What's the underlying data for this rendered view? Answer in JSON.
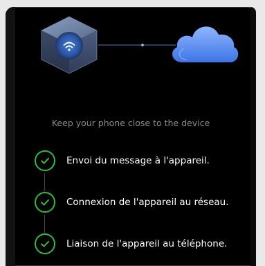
{
  "instruction": "Keep your phone close to the device",
  "steps": [
    {
      "label": "Envoi du message à l'appareil.",
      "status": "done"
    },
    {
      "label": "Connexion de l'appareil au réseau.",
      "status": "done"
    },
    {
      "label": "Liaison de l'appareil au téléphone.",
      "status": "done"
    }
  ],
  "icons": {
    "device": "wifi-device-cube-icon",
    "cloud": "cloud-icon",
    "check": "check-icon"
  },
  "colors": {
    "background": "#000000",
    "success": "#2bbd3e",
    "accent": "#3f7fe0"
  }
}
